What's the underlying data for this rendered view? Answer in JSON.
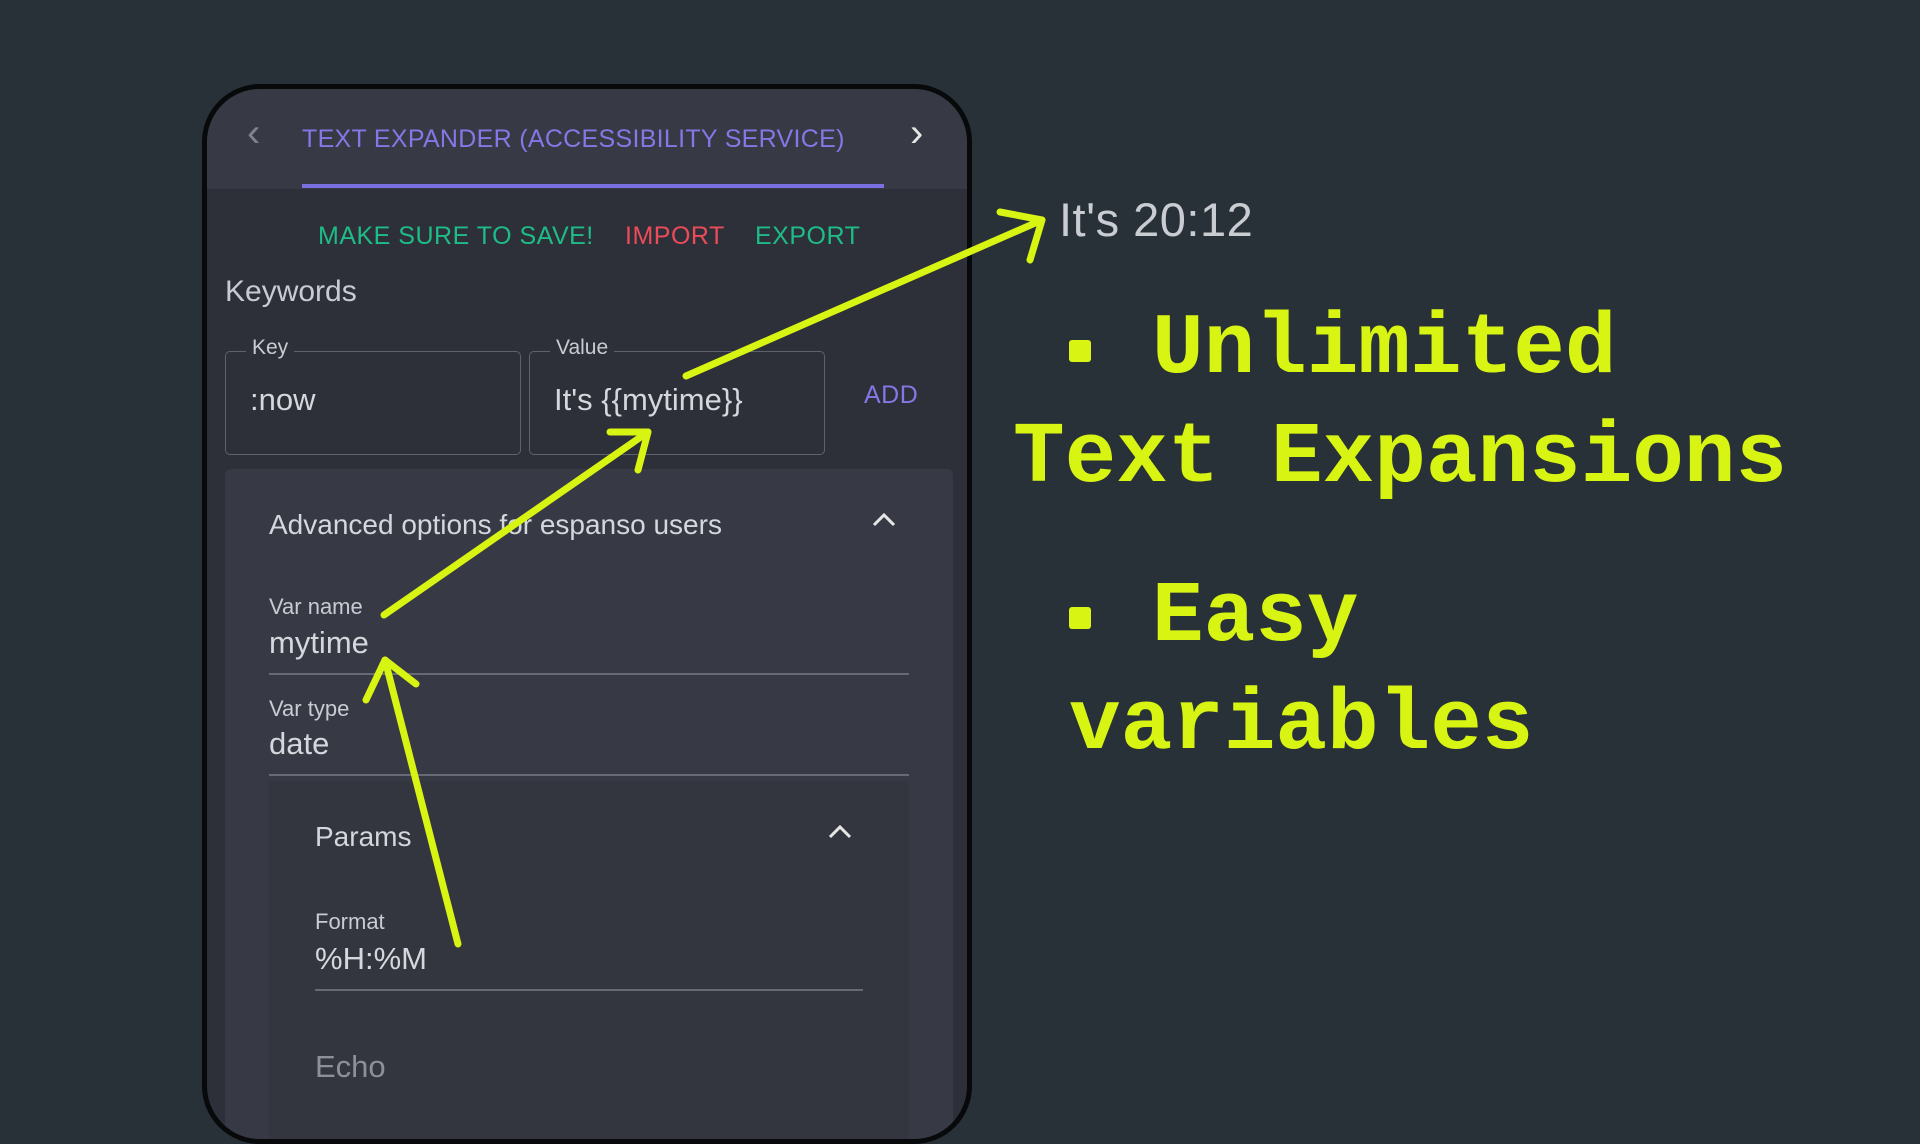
{
  "tabbar": {
    "prev_icon": "chevron-left-icon",
    "title": "TEXT EXPANDER (ACCESSIBILITY SERVICE)",
    "next_icon": "chevron-right-icon"
  },
  "actions": {
    "save_label": "MAKE SURE TO SAVE!",
    "import_label": "IMPORT",
    "export_label": "EXPORT"
  },
  "keywords": {
    "title": "Keywords",
    "key": {
      "label": "Key",
      "value": ":now"
    },
    "value": {
      "label": "Value",
      "value": "It's {{mytime}}"
    },
    "add_label": "ADD"
  },
  "advanced": {
    "title": "Advanced options for espanso users",
    "expanded_icon": "chevron-up-icon",
    "var_name": {
      "label": "Var name",
      "value": "mytime"
    },
    "var_type": {
      "label": "Var type",
      "value": "date"
    },
    "params": {
      "title": "Params",
      "format": {
        "label": "Format",
        "value": "%H:%M"
      },
      "echo_label": "Echo"
    }
  },
  "annotation": {
    "preview_text": "It's 20:12",
    "features": [
      {
        "line1": "Unlimited",
        "line2": "Text Expansions"
      },
      {
        "line1": "Easy",
        "line2": "variables"
      }
    ],
    "accent_color": "#d7f412"
  },
  "colors": {
    "background": "#283038",
    "surface": "#2d3038",
    "primary": "#8477e6",
    "green": "#1ebc86",
    "red": "#ec4b5a"
  }
}
